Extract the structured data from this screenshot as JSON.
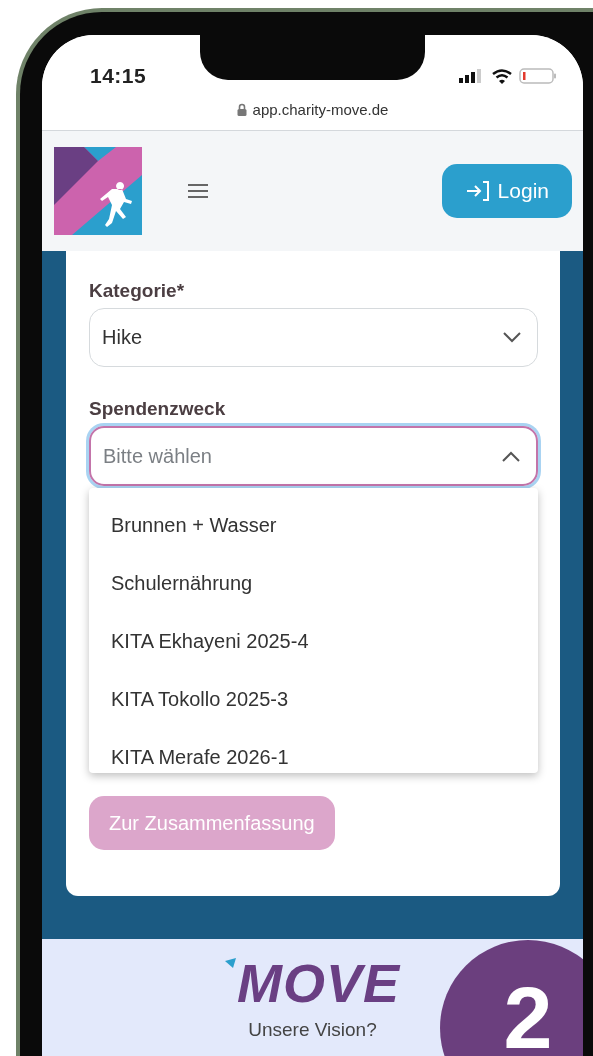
{
  "status_bar": {
    "time": "14:15"
  },
  "browser": {
    "url": "app.charity-move.de"
  },
  "header": {
    "login_button": "Login"
  },
  "form": {
    "fields": [
      {
        "label": "Kategorie*",
        "value": "Hike",
        "expanded": false
      },
      {
        "label": "Spendenzweck",
        "placeholder": "Bitte wählen",
        "expanded": true,
        "options": [
          "Brunnen + Wasser",
          "Schulernährung",
          "KITA Ekhayeni 2025-4",
          "KITA Tokollo 2025-3",
          "KITA Merafe 2026-1"
        ]
      }
    ],
    "submit_button": {
      "label": "Zur Zusammenfassung",
      "disabled": true
    }
  },
  "footer": {
    "logo": "MOVE",
    "tagline": "Unsere Vision?"
  },
  "step_badge": "2"
}
